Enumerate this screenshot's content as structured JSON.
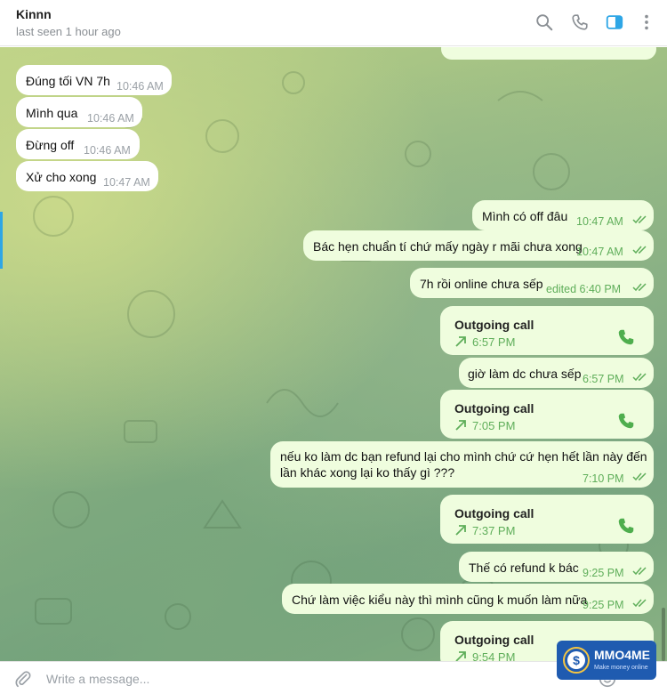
{
  "header": {
    "contact_name": "Kinnn",
    "status": "last seen 1 hour ago",
    "icons": [
      "search-icon",
      "phone-icon",
      "sidebar-toggle-icon",
      "more-vert-icon"
    ]
  },
  "colors": {
    "incoming_bubble": "#ffffff",
    "outgoing_bubble": "#effdde",
    "outgoing_meta": "#5fae5a",
    "accent": "#2ea6e6"
  },
  "messages": [
    {
      "dir": "in",
      "text": "Đúng tối VN 7h",
      "time": "10:46 AM"
    },
    {
      "dir": "in",
      "text": "Mình qua",
      "time": "10:46 AM"
    },
    {
      "dir": "in",
      "text": "Đừng off",
      "time": "10:46 AM"
    },
    {
      "dir": "in",
      "text": "Xử cho xong",
      "time": "10:47 AM"
    },
    {
      "dir": "out",
      "text": "Mình có off đâu",
      "time": "10:47 AM"
    },
    {
      "dir": "out",
      "text": "Bác hẹn chuẩn tí chứ mấy ngày r mãi chưa xong",
      "time": "10:47 AM"
    },
    {
      "dir": "out",
      "text": "7h rồi online chưa sếp",
      "time": "edited 6:40 PM"
    },
    {
      "dir": "out",
      "type": "call",
      "title": "Outgoing call",
      "time": "6:57 PM"
    },
    {
      "dir": "out",
      "text": "giờ làm dc chưa sếp",
      "time": "6:57 PM"
    },
    {
      "dir": "out",
      "type": "call",
      "title": "Outgoing call",
      "time": "7:05 PM"
    },
    {
      "dir": "out",
      "text_line1": "nếu ko làm dc bạn refund lại cho mình chứ cứ hẹn hết lần này đến",
      "text_line2": "lần khác xong lại ko thấy gì ???",
      "time": "7:10 PM"
    },
    {
      "dir": "out",
      "type": "call",
      "title": "Outgoing call",
      "time": "7:37 PM"
    },
    {
      "dir": "out",
      "text": "Thế có refund k bác",
      "time": "9:25 PM"
    },
    {
      "dir": "out",
      "text": "Chứ làm việc kiểu này thì mình cũng k muốn làm nữa",
      "time": "9:25 PM"
    },
    {
      "dir": "out",
      "type": "call",
      "title": "Outgoing call",
      "time": "9:54 PM"
    }
  ],
  "composer": {
    "placeholder": "Write a message..."
  },
  "watermark": {
    "title": "MMO4ME",
    "subtitle": "Make money online"
  }
}
